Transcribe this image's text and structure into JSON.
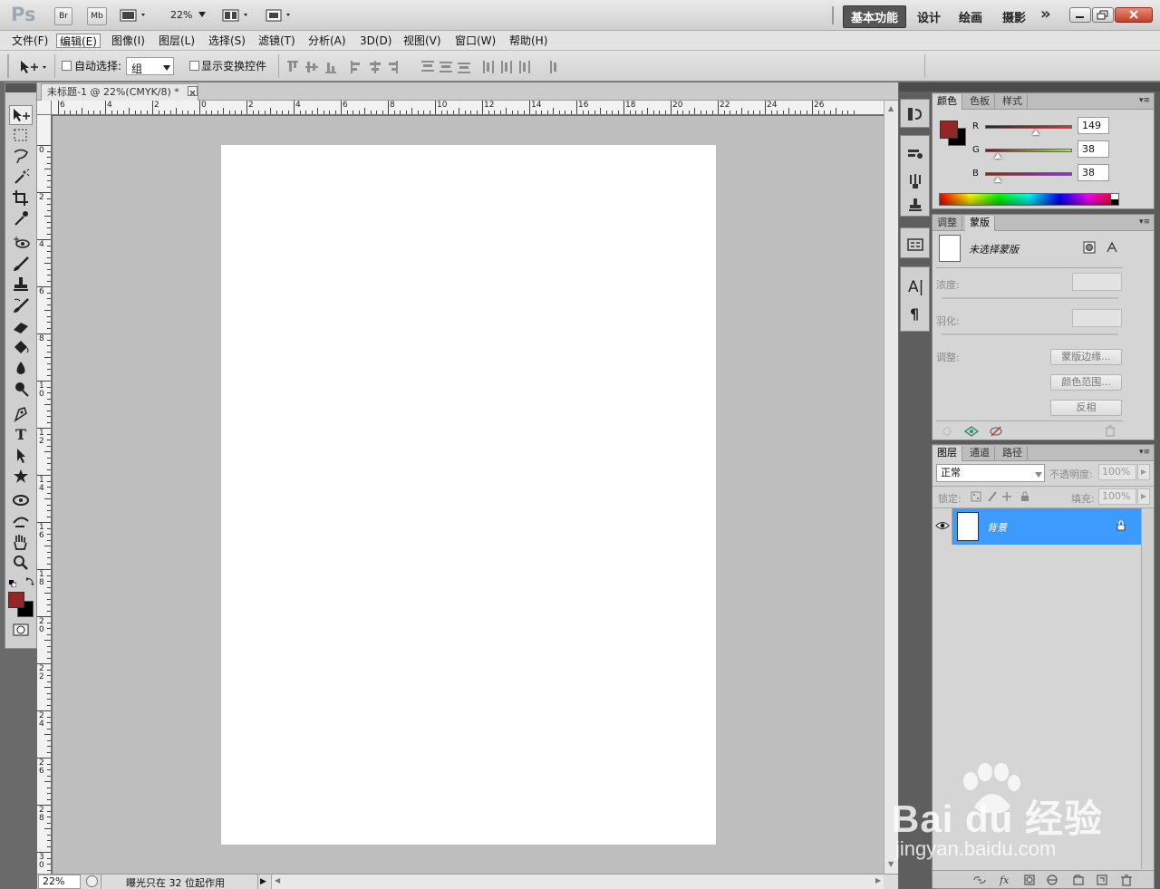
{
  "titlebar": {
    "logo": "Ps",
    "bridge_btn": "Br",
    "minibridge_btn": "Mb",
    "zoom": "22%",
    "workspaces": [
      "基本功能",
      "设计",
      "绘画",
      "摄影"
    ],
    "more": "»"
  },
  "menu": [
    "文件(F)",
    "编辑(E)",
    "图像(I)",
    "图层(L)",
    "选择(S)",
    "滤镜(T)",
    "分析(A)",
    "3D(D)",
    "视图(V)",
    "窗口(W)",
    "帮助(H)"
  ],
  "options": {
    "auto_select_label": "自动选择:",
    "auto_select_value": "组",
    "show_transform_label": "显示变换控件"
  },
  "document": {
    "tab_title": "未标题-1 @ 22%(CMYK/8) *",
    "zoom_status": "22%",
    "status_text": "曝光只在 32 位起作用"
  },
  "rulers": {
    "h_labels": [
      "6",
      "4",
      "2",
      "0",
      "2",
      "4",
      "6",
      "8",
      "10",
      "12",
      "14",
      "16",
      "18",
      "20",
      "22",
      "24",
      "26"
    ],
    "v_labels": [
      "0",
      "2",
      "4",
      "6",
      "8",
      "10",
      "12",
      "14",
      "16",
      "18",
      "20",
      "22",
      "24",
      "26",
      "28",
      "30"
    ]
  },
  "color_panel": {
    "tabs": [
      "颜色",
      "色板",
      "样式"
    ],
    "r_label": "R",
    "g_label": "G",
    "b_label": "B",
    "r": 149,
    "g": 38,
    "b": 38,
    "r_value": "149",
    "g_value": "38",
    "b_value": "38",
    "foreground": "#952626",
    "background": "#000000"
  },
  "mask_panel": {
    "tabs": [
      "调整",
      "蒙版"
    ],
    "status": "未选择蒙版",
    "density_label": "浓度:",
    "feather_label": "羽化:",
    "refine_label": "调整:",
    "mask_edge_btn": "蒙版边缘...",
    "color_range_btn": "颜色范围...",
    "invert_btn": "反相"
  },
  "layers_panel": {
    "tabs": [
      "图层",
      "通道",
      "路径"
    ],
    "blend_mode": "正常",
    "opacity_label": "不透明度:",
    "opacity": "100%",
    "lock_label": "锁定:",
    "fill_label": "填充:",
    "fill": "100%",
    "layers": [
      {
        "name": "背景",
        "visible": true,
        "locked": true,
        "selected": true
      }
    ]
  },
  "watermark": {
    "brand": "Bai du 经验",
    "url": "jingyan.baidu.com"
  }
}
